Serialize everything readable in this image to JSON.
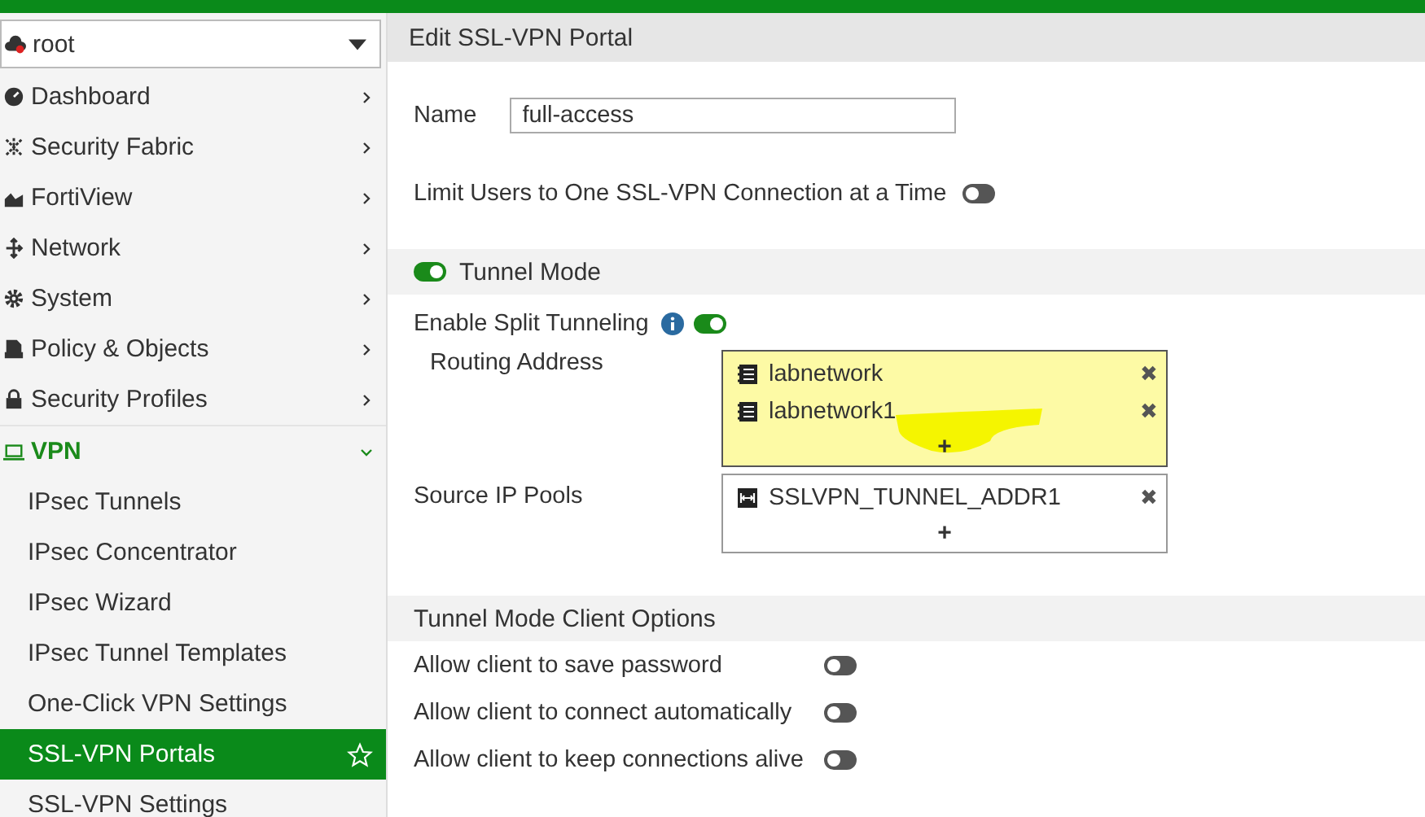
{
  "vdom": {
    "value": "root"
  },
  "sidebar": {
    "items": [
      {
        "label": "Dashboard",
        "kind": "dashboard",
        "expanded": false,
        "selected": false
      },
      {
        "label": "Security Fabric",
        "kind": "fabric",
        "expanded": false,
        "selected": false
      },
      {
        "label": "FortiView",
        "kind": "chart",
        "expanded": false,
        "selected": false
      },
      {
        "label": "Network",
        "kind": "network",
        "expanded": false,
        "selected": false
      },
      {
        "label": "System",
        "kind": "gear",
        "expanded": false,
        "selected": false
      },
      {
        "label": "Policy & Objects",
        "kind": "policy",
        "expanded": false,
        "selected": false
      },
      {
        "label": "Security Profiles",
        "kind": "lock",
        "expanded": false,
        "selected": false
      },
      {
        "label": "VPN",
        "kind": "laptop",
        "expanded": true,
        "selected": false,
        "children": [
          {
            "label": "IPsec Tunnels",
            "selected": false
          },
          {
            "label": "IPsec Concentrator",
            "selected": false
          },
          {
            "label": "IPsec Wizard",
            "selected": false
          },
          {
            "label": "IPsec Tunnel Templates",
            "selected": false
          },
          {
            "label": "One-Click VPN Settings",
            "selected": false
          },
          {
            "label": "SSL-VPN Portals",
            "selected": true
          },
          {
            "label": "SSL-VPN Settings",
            "selected": false
          }
        ]
      }
    ]
  },
  "panel": {
    "title": "Edit SSL-VPN Portal",
    "name": {
      "label": "Name",
      "value": "full-access"
    },
    "limit_users": {
      "label": "Limit Users to One SSL-VPN Connection at a Time",
      "on": false
    },
    "tunnel_mode": {
      "label": "Tunnel Mode",
      "on": true
    },
    "split_tunneling": {
      "label": "Enable Split Tunneling",
      "on": true
    },
    "routing_address": {
      "label": "Routing Address",
      "highlighted": true,
      "add": "+",
      "entries": [
        {
          "name": "labnetwork",
          "kind": "address",
          "remove": "✖"
        },
        {
          "name": "labnetwork1",
          "kind": "address",
          "remove": "✖"
        }
      ]
    },
    "source_ip_pools": {
      "label": "Source IP Pools",
      "highlighted": false,
      "add": "+",
      "entries": [
        {
          "name": "SSLVPN_TUNNEL_ADDR1",
          "kind": "range",
          "remove": "✖"
        }
      ]
    },
    "client_options": {
      "title": "Tunnel Mode Client Options",
      "options": [
        {
          "label": "Allow client to save password",
          "on": false
        },
        {
          "label": "Allow client to connect automatically",
          "on": false
        },
        {
          "label": "Allow client to keep connections alive",
          "on": false
        }
      ]
    }
  }
}
